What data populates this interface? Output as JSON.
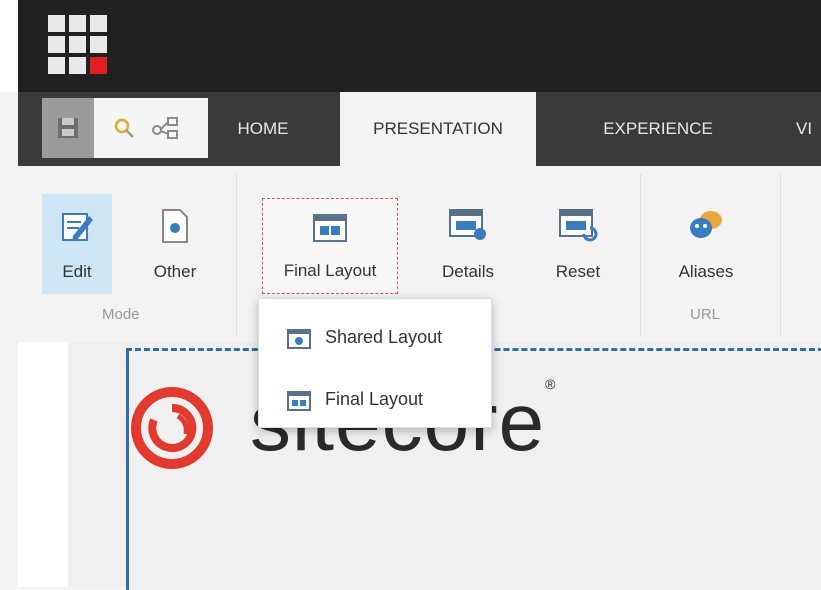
{
  "tabs": [
    {
      "label": "HOME"
    },
    {
      "label": "PRESENTATION"
    },
    {
      "label": "EXPERIENCE"
    },
    {
      "label": "VI"
    }
  ],
  "ribbon": {
    "edit": "Edit",
    "other": "Other",
    "final_layout": "Final Layout",
    "details": "Details",
    "reset": "Reset",
    "aliases": "Aliases",
    "groups": {
      "mode": "Mode",
      "url": "URL"
    }
  },
  "dropdown": {
    "items": [
      {
        "label": "Shared Layout"
      },
      {
        "label": "Final Layout"
      }
    ]
  },
  "logo": {
    "text": "sitecore",
    "trademark": "®"
  },
  "colors": {
    "accent_red": "#e02020",
    "active_blue": "#cfe6f7",
    "canvas_border": "#2f6ea3"
  }
}
